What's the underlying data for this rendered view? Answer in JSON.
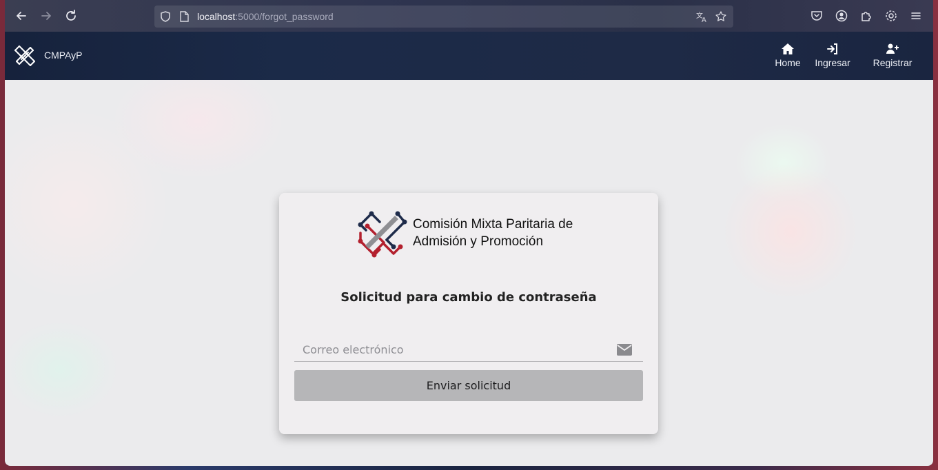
{
  "browser": {
    "url_host": "localhost",
    "url_path": ":5000/forgot_password",
    "icons": [
      "back-icon",
      "forward-icon",
      "reload-icon",
      "shield-icon",
      "page-icon",
      "translate-icon",
      "bookmark-star-icon",
      "pocket-icon",
      "account-icon",
      "extensions-icon",
      "settings-icon",
      "menu-icon"
    ]
  },
  "navbar": {
    "brand": "CMPAyP",
    "items": [
      {
        "label": "Home",
        "icon": "home-icon"
      },
      {
        "label": "Ingresar",
        "icon": "sign-in-icon"
      },
      {
        "label": "Registrar",
        "icon": "user-plus-icon"
      }
    ]
  },
  "card": {
    "org_name_line1": "Comisión Mixta Paritaria de",
    "org_name_line2": "Admisión y Promoción",
    "title": "Solicitud para cambio de contraseña",
    "email_placeholder": "Correo electrónico",
    "submit_label": "Enviar solicitud"
  },
  "colors": {
    "navbar_bg": "#1b2a48",
    "logo_navy": "#1e2b4a",
    "logo_red": "#b3202e",
    "logo_gray": "#8f8f93",
    "button_bg": "#b6b6b8"
  }
}
